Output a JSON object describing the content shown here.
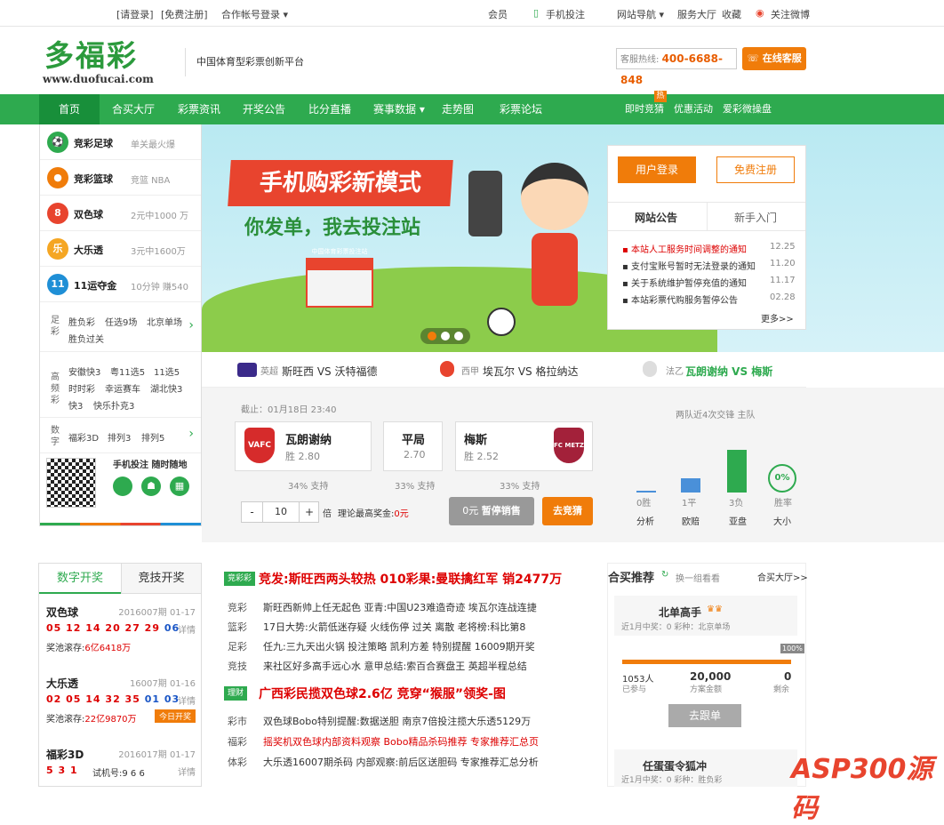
{
  "topbar": {
    "login": "[请登录]",
    "register": "[免费注册]",
    "partner_login": "合作帐号登录",
    "member": "会员",
    "mobile_bet": "手机投注",
    "site_nav": "网站导航",
    "service": "服务大厅",
    "favorite": "收藏",
    "weibo": "关注微博"
  },
  "header": {
    "logo_cn": "多福彩",
    "logo_en": "www.duofucai.com",
    "slogan": "中国体育型彩票创新平台",
    "hotline_label": "客服热线:",
    "hotline": "400-6688-848",
    "online_service": "在线客服"
  },
  "nav": {
    "items": [
      "首页",
      "合买大厅",
      "彩票资讯",
      "开奖公告",
      "比分直播",
      "赛事数据",
      "走势图",
      "彩票论坛"
    ],
    "right": [
      "即时竞猜",
      "优惠活动",
      "爱彩微操盘"
    ],
    "hot": "热"
  },
  "lottery": {
    "rows": [
      {
        "name": "竞彩足球",
        "desc": "单关最火爆",
        "color": "#2eaa4f",
        "icon": "football-icon"
      },
      {
        "name": "竞彩篮球",
        "desc": "竞篮 NBA",
        "color": "#f07c0a",
        "icon": "basketball-icon"
      },
      {
        "name": "双色球",
        "desc": "2元中1000 万",
        "color": "#e8442e",
        "icon": "ssq-icon"
      },
      {
        "name": "大乐透",
        "desc": "3元中1600万",
        "color": "#f5a623",
        "icon": "dlt-icon"
      },
      {
        "name": "11运夺金",
        "desc": "10分钟 赚540",
        "color": "#1f8fd6",
        "icon": "sd11x5-icon"
      }
    ],
    "group1": {
      "cat": "足彩",
      "links": [
        "胜负彩",
        "任选9场",
        "北京单场",
        "胜负过关"
      ]
    },
    "group2": {
      "cat": "高频彩",
      "links": [
        "安徽快3",
        "粤11选5",
        "11选5",
        "时时彩",
        "幸运赛车",
        "湖北快3",
        "快3",
        "快乐扑克3"
      ]
    },
    "group3": {
      "cat": "数字",
      "links": [
        "福彩3D",
        "排列3",
        "排列5"
      ]
    },
    "mobile": "手机投注 随时随地"
  },
  "banner": {
    "title": "手机购彩新模式",
    "subtitle": "你发单，我去投注站",
    "shop": "中国体育彩票投注站"
  },
  "login_box": {
    "login": "用户登录",
    "register": "免费注册",
    "tab1": "网站公告",
    "tab2": "新手入门",
    "more": "更多>>",
    "news": [
      {
        "text": "本站人工服务时间调整的通知",
        "date": "12.25",
        "hot": true
      },
      {
        "text": "支付宝账号暂时无法登录的通知",
        "date": "11.20",
        "hot": false
      },
      {
        "text": "关于系统维护暂停充值的通知",
        "date": "11.17",
        "hot": false
      },
      {
        "text": "本站彩票代购服务暂停公告",
        "date": "02.28",
        "hot": false
      }
    ]
  },
  "matches": [
    {
      "league": "英超",
      "text": "斯旺西 VS 沃特福德"
    },
    {
      "league": "西甲",
      "text": "埃瓦尔 VS 格拉纳达"
    },
    {
      "league": "法乙",
      "text": "瓦朗谢纳 VS 梅斯"
    }
  ],
  "bet": {
    "deadline": "截止：01月18日 23:40",
    "home": {
      "name": "瓦朗谢纳",
      "odds": "胜 2.80",
      "support": "34% 支持",
      "badge": "VAFC"
    },
    "draw": {
      "name": "平局",
      "odds": "2.70",
      "support": "33% 支持"
    },
    "away": {
      "name": "梅斯",
      "odds": "胜 2.52",
      "support": "33% 支持",
      "badge": "FC METZ"
    },
    "qty": "10",
    "minus": "-",
    "plus": "+",
    "multiple": "倍",
    "max_prize_label": "理论最高奖金:",
    "max_prize": "0元",
    "stop_amount": "0元",
    "stop": "暂停销售",
    "go": "去竞猜",
    "stats_title": "两队近4次交锋 主队",
    "stats": [
      {
        "value": "0胜",
        "label": "分析",
        "level": 0
      },
      {
        "value": "1平",
        "label": "欧赔",
        "level": 0.33
      },
      {
        "value": "3负",
        "label": "亚盘",
        "level": 1.0
      }
    ],
    "winrate": "0%",
    "winrate_label": "胜率",
    "size_label": "大小"
  },
  "draw_panel": {
    "tab1": "数字开奖",
    "tab2": "竞技开奖",
    "items": [
      {
        "name": "双色球",
        "issue": "2016007期",
        "date": "01-17",
        "red": "05 12 14 20 27 29",
        "blue": "06",
        "pool_label": "奖池滚存:",
        "pool": "6亿6418万",
        "detail": "详情"
      },
      {
        "name": "大乐透",
        "issue": "16007期",
        "date": "01-16",
        "red": "02 05 14 32 35",
        "blue": "01 03",
        "pool_label": "奖池滚存:",
        "pool": "22亿9870万",
        "detail": "详情",
        "today": "今日开奖"
      },
      {
        "name": "福彩3D",
        "issue": "2016017期",
        "date": "01-17",
        "red": "5 3 1",
        "blue": "",
        "pool_label": "试机号:",
        "pool": "9 6 6",
        "detail": "详情"
      }
    ]
  },
  "news": {
    "tag1": "竞彩彩",
    "head1": "竞发:斯旺西两头较热 010彩果:曼联擒红军 销2477万",
    "list1": [
      {
        "cat": "竞彩",
        "text": "斯旺西新帅上任无起色  亚青:中国U23难造奇迹  埃瓦尔连战连捷"
      },
      {
        "cat": "篮彩",
        "text": "17日大势:火箭低迷存疑  火线伤停  过关  离散  老将榜:科比第8"
      },
      {
        "cat": "足彩",
        "text": "任九:三九天出火锅  投注策略  凯利方差  特别提醒  16009期开奖"
      },
      {
        "cat": "竞技",
        "text": "来社区好多高手远心水  意甲总结:索百合赛盘王  英超半程总结"
      }
    ],
    "tag2": "理财",
    "head2": "广西彩民揽双色球2.6亿  竞穿“猴服”领奖-图",
    "list2": [
      {
        "cat": "彩市",
        "text": "双色球Bobo特别提醒:数据送胆  南京7倍投注揽大乐透5129万"
      },
      {
        "cat": "福彩",
        "text": "摇奖机双色球内部资料观察  Bobo精品杀码推荐  专家推荐汇总页"
      },
      {
        "cat": "体彩",
        "text": "大乐透16007期杀码  内部观察:前后区送胆码  专家推荐汇总分析"
      }
    ]
  },
  "recommend": {
    "title": "合买推荐",
    "refresh": "换一组看看",
    "hall": "合买大厅>>",
    "card1": {
      "name": "北单高手",
      "recent": "近1月中奖：0",
      "type": "彩种：北京单场"
    },
    "progress_pct": "100%",
    "progress": 1.0,
    "stats": [
      {
        "v": "1053人",
        "l": "已参与"
      },
      {
        "v": "20,000",
        "l": "方案金额"
      },
      {
        "v": "0",
        "l": "剩余"
      }
    ],
    "follow": "去跟单",
    "card2": {
      "name": "任蛋蛋令狐冲",
      "recent": "近1月中奖：0",
      "type": "彩种：胜负彩"
    }
  },
  "watermark": "ASP300源码",
  "colors": {
    "green": "#2eaa4f",
    "orange": "#f07c0a",
    "red": "#e8442e"
  }
}
